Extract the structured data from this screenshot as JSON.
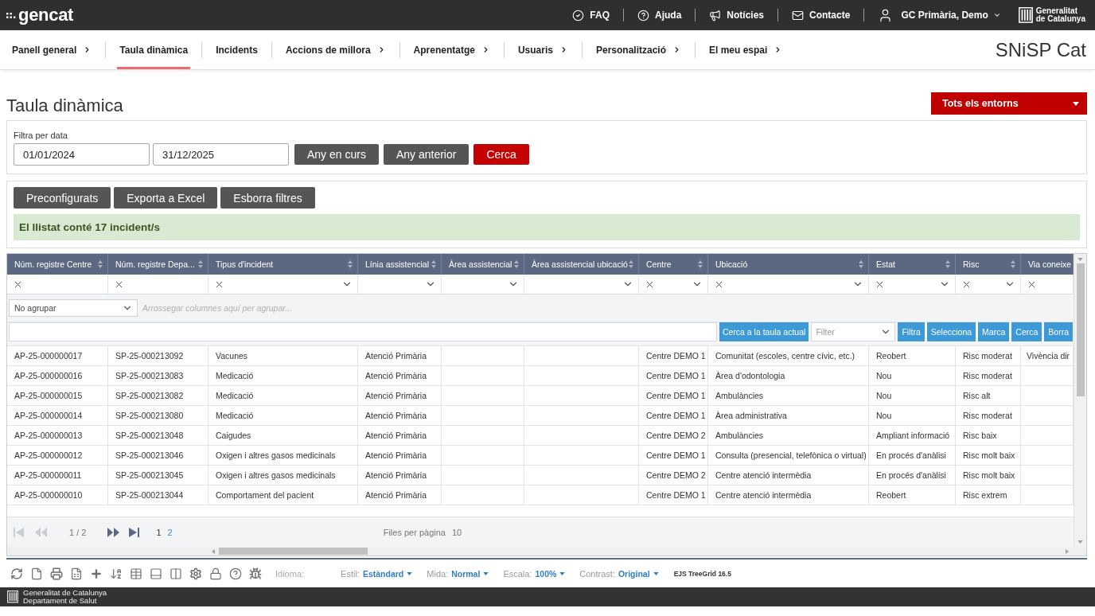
{
  "top_bar": {
    "logo": "gencat",
    "links": [
      "FAQ",
      "Ajuda",
      "Notícies",
      "Contacte"
    ],
    "user": "GC Primària, Demo",
    "org_logo": [
      "Generalitat",
      "de Catalunya"
    ]
  },
  "nav": {
    "items": [
      {
        "label": "Panell general",
        "selected": false,
        "submenu": true
      },
      {
        "label": "Taula dinàmica",
        "selected": true,
        "submenu": false
      },
      {
        "label": "Incidents",
        "selected": false,
        "submenu": false
      },
      {
        "label": "Accions de millora",
        "selected": false,
        "submenu": true
      },
      {
        "label": "Aprenentatge",
        "selected": false,
        "submenu": true
      },
      {
        "label": "Usuaris",
        "selected": false,
        "submenu": true
      },
      {
        "label": "Personalització",
        "selected": false,
        "submenu": true
      },
      {
        "label": "El meu espai",
        "selected": false,
        "submenu": true
      }
    ],
    "brand": "SNiSP Cat"
  },
  "page": {
    "title": "Taula dinàmica",
    "environment_menu": "Tots els entorns"
  },
  "date_filter": {
    "label": "Filtra per data",
    "from": "01/01/2024",
    "to": "31/12/2025",
    "buttons": [
      {
        "label": "Any en curs",
        "kind": "secondary"
      },
      {
        "label": "Any anterior",
        "kind": "secondary"
      },
      {
        "label": "Cerca",
        "kind": "primary"
      }
    ]
  },
  "actions": [
    "Preconfigurats",
    "Exporta a Excel",
    "Esborra filtres"
  ],
  "alert": "El llistat conté 17 incident/s",
  "grid": {
    "columns": [
      {
        "label": "Núm. registre Centre",
        "sortable": true,
        "clear": true,
        "dropdown": false
      },
      {
        "label": "Núm. registre Depa...",
        "sortable": true,
        "clear": true,
        "dropdown": false
      },
      {
        "label": "Tipus d'incident",
        "sortable": true,
        "clear": true,
        "dropdown": true
      },
      {
        "label": "Línia assistencial",
        "sortable": true,
        "clear": false,
        "dropdown": true
      },
      {
        "label": "Àrea assistencial",
        "sortable": true,
        "clear": false,
        "dropdown": true
      },
      {
        "label": "Àrea assistencial ubicació",
        "sortable": true,
        "clear": false,
        "dropdown": true
      },
      {
        "label": "Centre",
        "sortable": true,
        "clear": true,
        "dropdown": true
      },
      {
        "label": "Ubicació",
        "sortable": true,
        "clear": true,
        "dropdown": true
      },
      {
        "label": "Estat",
        "sortable": true,
        "clear": true,
        "dropdown": true
      },
      {
        "label": "Risc",
        "sortable": true,
        "clear": true,
        "dropdown": true
      },
      {
        "label": "Via coneixe",
        "sortable": false,
        "clear": true,
        "dropdown": false
      }
    ],
    "grouping": {
      "value": "No agrupar",
      "hint": "Arrossegar columnes aquí per agrupar..."
    },
    "search": {
      "button": "Cerca a la taula actual",
      "filter_placeholder": "Filter",
      "actions": [
        "Filtra",
        "Selecciona",
        "Marca",
        "Cerca",
        "Borra"
      ]
    },
    "rows": [
      {
        "num_registre_centre": "AP-25-000000017",
        "column_2": "SP-25-000213092",
        "tipus_incident": "Vacunes",
        "linia_assistencial": "Atenció Primària",
        "centre": "Centre DEMO 1",
        "ubicacio": "Comunitat (escoles, centre cívic, etc.)",
        "estat": "Reobert",
        "risc": "Risc moderat",
        "column_11": "Vivència dir"
      },
      {
        "num_registre_centre": "AP-25-000000016",
        "column_2": "SP-25-000213083",
        "tipus_incident": "Medicació",
        "linia_assistencial": "Atenció Primària",
        "centre": "Centre DEMO 1",
        "ubicacio": "Àrea d'odontologia",
        "estat": "Nou",
        "risc": "Risc moderat"
      },
      {
        "num_registre_centre": "AP-25-000000015",
        "column_2": "SP-25-000213082",
        "tipus_incident": "Medicació",
        "linia_assistencial": "Atenció Primària",
        "centre": "Centre DEMO 1",
        "ubicacio": "Ambulàncies",
        "estat": "Nou",
        "risc": "Risc alt"
      },
      {
        "num_registre_centre": "AP-25-000000014",
        "column_2": "SP-25-000213080",
        "tipus_incident": "Medicació",
        "linia_assistencial": "Atenció Primària",
        "centre": "Centre DEMO 1",
        "ubicacio": "Àrea administrativa",
        "estat": "Nou",
        "risc": "Risc moderat"
      },
      {
        "num_registre_centre": "AP-25-000000013",
        "column_2": "SP-25-000213048",
        "tipus_incident": "Caigudes",
        "linia_assistencial": "Atenció Primària",
        "centre": "Centre DEMO 2",
        "ubicacio": "Ambulàncies",
        "estat": "Ampliant informació",
        "risc": "Risc baix"
      },
      {
        "num_registre_centre": "AP-25-000000012",
        "column_2": "SP-25-000213046",
        "tipus_incident": "Oxigen i altres gasos medicinals",
        "linia_assistencial": "Atenció Primària",
        "centre": "Centre DEMO 1",
        "ubicacio": "Consulta (presencial, telefònica o virtual)",
        "estat": "En procés d'anàlisi",
        "risc": "Risc molt baix"
      },
      {
        "num_registre_centre": "AP-25-000000011",
        "column_2": "SP-25-000213045",
        "tipus_incident": "Oxigen i altres gasos medicinals",
        "linia_assistencial": "Atenció Primària",
        "centre": "Centre DEMO 2",
        "ubicacio": "Centre atenció intermèdia",
        "estat": "En procés d'anàlisi",
        "risc": "Risc molt baix"
      },
      {
        "num_registre_centre": "AP-25-000000010",
        "column_2": "SP-25-000213044",
        "tipus_incident": "Comportament del pacient",
        "linia_assistencial": "Atenció Primària",
        "centre": "Centre DEMO 1",
        "ubicacio": "Centre atenció intermèdia",
        "estat": "Reobert",
        "risc": "Risc extrem"
      }
    ],
    "pager": {
      "back": [
        {
          "kind": "first",
          "disabled": true
        },
        {
          "kind": "previous",
          "disabled": true
        }
      ],
      "position": "1 / 2",
      "forward": [
        {
          "kind": "next",
          "disabled": false
        },
        {
          "kind": "last",
          "disabled": false
        }
      ],
      "pages": [
        {
          "label": "1",
          "selected": true
        },
        {
          "label": "2",
          "selected": false
        }
      ],
      "rows_per_page_label": "Files per pàgina",
      "rows_per_page": "10"
    }
  },
  "toolbar": {
    "language_label": "Idioma:",
    "settings": [
      {
        "label": "Estil:",
        "value": "Estàndard"
      },
      {
        "label": "Mida:",
        "value": "Normal"
      },
      {
        "label": "Escala:",
        "value": "100%"
      },
      {
        "label": "Contrast:",
        "value": "Original"
      }
    ],
    "version": "EJS TreeGrid 16.5"
  },
  "footer": [
    "Generalitat de Catalunya",
    "Departament de Salut"
  ]
}
